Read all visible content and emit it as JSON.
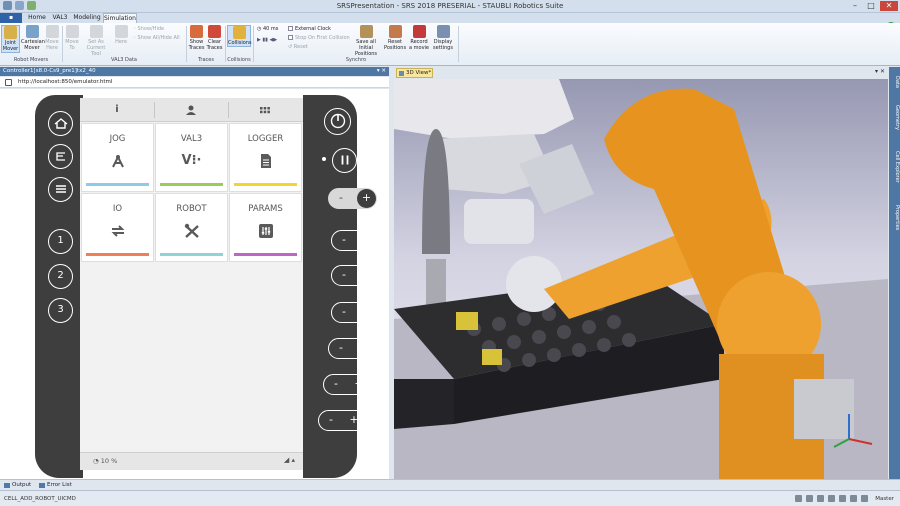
{
  "window": {
    "title": "SRSPresentation - SRS 2018 PRESERIAL - STAUBLI Robotics Suite"
  },
  "tabs": [
    {
      "label": "Home",
      "active": false
    },
    {
      "label": "VAL3",
      "active": false
    },
    {
      "label": "Modeling",
      "active": false
    },
    {
      "label": "Simulation",
      "active": true
    }
  ],
  "ribbon": {
    "joint_mover": "Joint\nMover",
    "cartesian_mover": "Cartesian\nMover",
    "move_here": "Move\nHere",
    "move_to": "Move\nTo",
    "set_as_current_tool": "Set As\nCurrent Tool",
    "here": "Here",
    "show_hide": "Show/Hide",
    "show_all_hide_all": "Show All/Hide All",
    "show_traces": "Show\nTraces",
    "clear_traces": "Clear\nTraces",
    "collisions": "Collisions",
    "time_step": "40 ms",
    "external_clock": "External Clock",
    "stop_on_first_collision": "Stop On First Collision",
    "reset": "Reset",
    "save_all_initial_positions": "Save all Initial\nPositions",
    "reset_positions": "Reset\nPositions",
    "record_a_movie": "Record\na movie",
    "display_settings": "Display\nsettings",
    "groups": {
      "robot_movers": "Robot Movers",
      "val3_data": "VAL3 Data",
      "traces": "Traces",
      "collisions": "Collisions",
      "synchro": "Synchro"
    }
  },
  "controller_panel": {
    "title": "Controller1[s8.0-Cs9_pre1]tx2_40",
    "url": "http://localhost:850/emulator.html"
  },
  "pendant": {
    "side_numbers": [
      "1",
      "2",
      "3"
    ],
    "plus_minus": {
      "minus": "-",
      "plus": "+"
    },
    "header_icons": [
      "i",
      "user-icon",
      "grid-icon"
    ],
    "tiles": [
      {
        "label": "JOG",
        "icon": "jog-icon",
        "color": "#8ecaea"
      },
      {
        "label": "VAL3",
        "icon": "val3-icon",
        "color": "#9dcc56"
      },
      {
        "label": "LOGGER",
        "icon": "logger-icon",
        "color": "#f2d52d"
      },
      {
        "label": "IO",
        "icon": "io-icon",
        "color": "#ef7f55"
      },
      {
        "label": "ROBOT",
        "icon": "robot-icon",
        "color": "#8fd3d8"
      },
      {
        "label": "PARAMS",
        "icon": "params-icon",
        "color": "#bd66c4"
      }
    ],
    "speed": "10 %"
  },
  "view3d": {
    "tab_label": "3D View*"
  },
  "right_panels": [
    "Data",
    "Geometry",
    "Cell Explorer",
    "Properties"
  ],
  "bottom_tabs": [
    "Output",
    "Error List"
  ],
  "status": {
    "text": "CELL_ADD_ROBOT_UICMD",
    "mode": "Master"
  },
  "colors": {
    "robot_orange": "#eea12e",
    "ribbon_blue": "#4e77a4",
    "pendant_dark": "#3e3e3e"
  }
}
